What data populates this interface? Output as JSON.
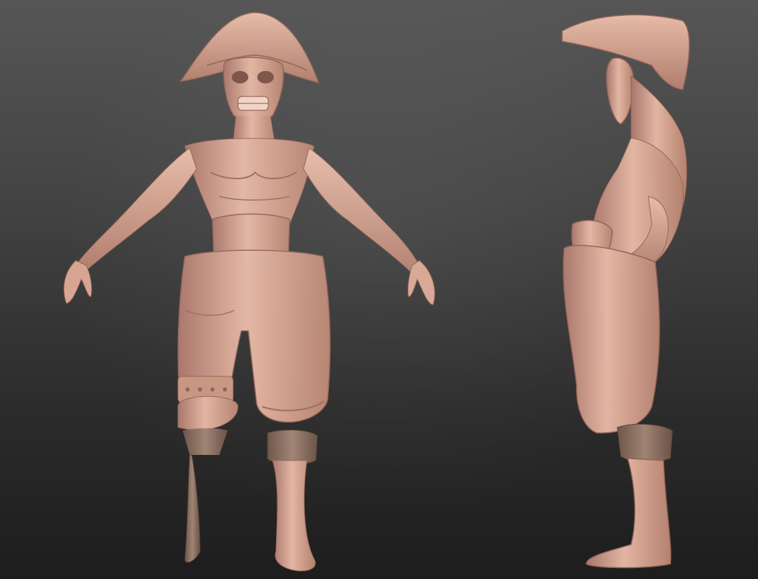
{
  "scene": {
    "background_top": "#565656",
    "background_bottom": "#1d1d1d",
    "clay_color": "#d4a08c",
    "clay_shadow": "#a9766a",
    "clay_highlight": "#ecc4b2",
    "wood_color": "#8a6e60",
    "views": [
      "front",
      "side"
    ]
  }
}
